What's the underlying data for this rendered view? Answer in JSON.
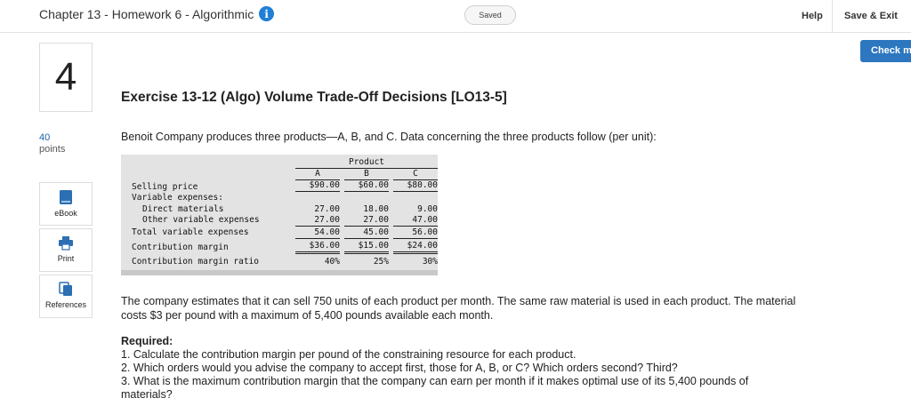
{
  "header": {
    "title": "Chapter 13 - Homework 6 - Algorithmic",
    "info_glyph": "i",
    "saved": "Saved",
    "help": "Help",
    "save_exit": "Save & Exit",
    "check": "Check m"
  },
  "question": {
    "number": "4",
    "points_value": "40",
    "points_label": "points"
  },
  "sidebar": {
    "ebook": "eBook",
    "print": "Print",
    "references": "References"
  },
  "content": {
    "heading": "Exercise 13-12 (Algo) Volume Trade-Off Decisions [LO13-5]",
    "intro": "Benoit Company produces three products—A, B, and C. Data concerning the three products follow (per unit):",
    "paragraph": "The company estimates that it can sell 750 units of each product per month. The same raw material is used in each product. The material costs $3 per pound with a maximum of 5,400 pounds available each month.",
    "required_title": "Required:",
    "req1": "1. Calculate the contribution margin per pound of the constraining resource for each product.",
    "req2": "2. Which orders would you advise the company to accept first, those for A, B, or C? Which orders second? Third?",
    "req3": "3. What is the maximum contribution margin that the company can earn per month if it makes optimal use of its 5,400 pounds of materials?"
  },
  "table": {
    "product_header": "Product",
    "col_a": "A",
    "col_b": "B",
    "col_c": "C",
    "rows": {
      "selling_price": {
        "label": "Selling price",
        "a": "$90.00",
        "b": "$60.00",
        "c": "$80.00"
      },
      "variable_expenses": {
        "label": "Variable expenses:"
      },
      "direct_materials": {
        "label": "Direct materials",
        "a": "27.00",
        "b": "18.00",
        "c": "9.00"
      },
      "other_variable": {
        "label": "Other variable expenses",
        "a": "27.00",
        "b": "27.00",
        "c": "47.00"
      },
      "total_variable": {
        "label": "Total variable expenses",
        "a": "54.00",
        "b": "45.00",
        "c": "56.00"
      },
      "contribution_margin": {
        "label": "Contribution margin",
        "a": "$36.00",
        "b": "$15.00",
        "c": "$24.00"
      },
      "cm_ratio": {
        "label": "Contribution margin ratio",
        "a": "40%",
        "b": "25%",
        "c": "30%"
      }
    }
  }
}
